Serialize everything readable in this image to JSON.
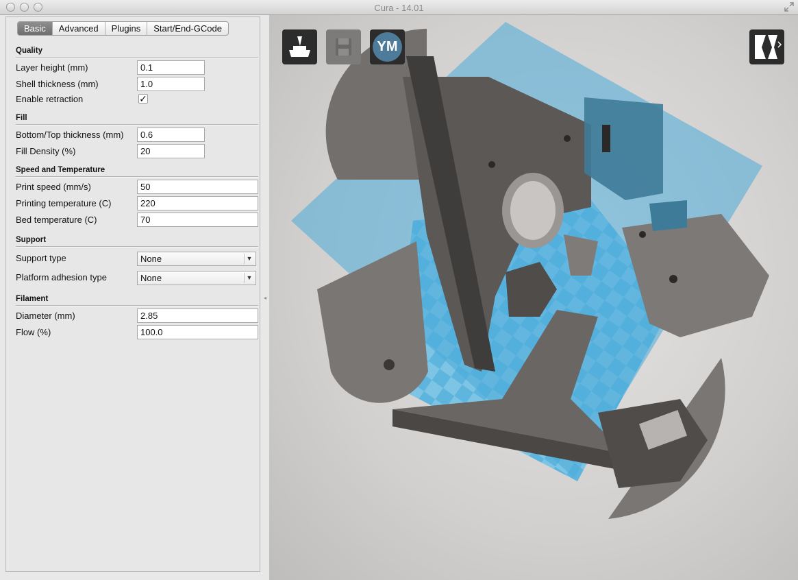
{
  "window": {
    "title": "Cura - 14.01"
  },
  "tabs": [
    {
      "label": "Basic",
      "active": true
    },
    {
      "label": "Advanced",
      "active": false
    },
    {
      "label": "Plugins",
      "active": false
    },
    {
      "label": "Start/End-GCode",
      "active": false
    }
  ],
  "sections": {
    "quality": "Quality",
    "fill": "Fill",
    "speed": "Speed and Temperature",
    "support": "Support",
    "filament": "Filament"
  },
  "quality": {
    "layer_height_label": "Layer height (mm)",
    "layer_height": "0.1",
    "shell_thickness_label": "Shell thickness (mm)",
    "shell_thickness": "1.0",
    "retraction_label": "Enable retraction",
    "retraction_checked": true
  },
  "fill": {
    "bottom_top_label": "Bottom/Top thickness (mm)",
    "bottom_top": "0.6",
    "density_label": "Fill Density (%)",
    "density": "20"
  },
  "speed": {
    "print_speed_label": "Print speed (mm/s)",
    "print_speed": "50",
    "print_temp_label": "Printing temperature (C)",
    "print_temp": "220",
    "bed_temp_label": "Bed temperature (C)",
    "bed_temp": "70"
  },
  "support": {
    "type_label": "Support type",
    "type_value": "None",
    "adhesion_label": "Platform adhesion type",
    "adhesion_value": "None"
  },
  "filament": {
    "diameter_label": "Diameter (mm)",
    "diameter": "2.85",
    "flow_label": "Flow (%)",
    "flow": "100.0"
  },
  "toolbar": {
    "load_icon": "load-model-icon",
    "save_icon": "save-gcode-icon",
    "ym_label": "YM",
    "view_icon": "view-mode-icon"
  },
  "colors": {
    "bed": "#4aa9d8",
    "model": "#6f6b69",
    "overhang": "#3b7fa0"
  }
}
